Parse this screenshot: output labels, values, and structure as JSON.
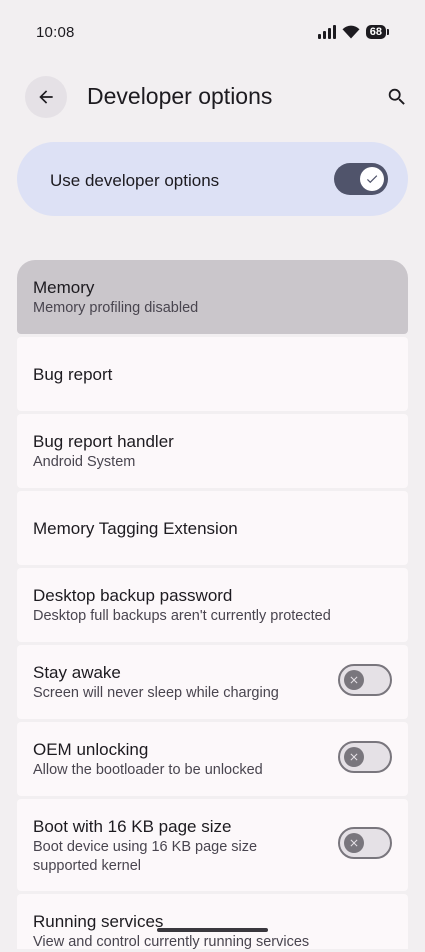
{
  "status_bar": {
    "time": "10:08",
    "battery": "68",
    "icons": [
      "signal-icon",
      "wifi-icon",
      "battery-icon"
    ]
  },
  "top_bar": {
    "title": "Developer options",
    "back_icon": "arrow-back-icon",
    "search_icon": "search-icon"
  },
  "master_toggle": {
    "label": "Use developer options",
    "state": "on"
  },
  "items": [
    {
      "title": "Memory",
      "summary": "Memory profiling disabled"
    },
    {
      "title": "Bug report",
      "summary": ""
    },
    {
      "title": "Bug report handler",
      "summary": "Android System"
    },
    {
      "title": "Memory Tagging Extension",
      "summary": ""
    },
    {
      "title": "Desktop backup password",
      "summary": "Desktop full backups aren't currently protected"
    },
    {
      "title": "Stay awake",
      "summary": "Screen will never sleep while charging",
      "toggle": "off"
    },
    {
      "title": "OEM unlocking",
      "summary": "Allow the bootloader to be unlocked",
      "toggle": "off"
    },
    {
      "title": "Boot with 16 KB page size",
      "summary": "Boot device using 16 KB page size supported kernel",
      "toggle": "off"
    },
    {
      "title": "Running services",
      "summary": "View and control currently running services"
    }
  ],
  "colors": {
    "background": "#f2eff1",
    "card": "#fcf8fa",
    "highlight": "#cac6cb",
    "toggle_card": "#dde1f5",
    "switch_on": "#50546b",
    "switch_off_track": "#e5e1e6",
    "switch_off_outline": "#79767d"
  }
}
